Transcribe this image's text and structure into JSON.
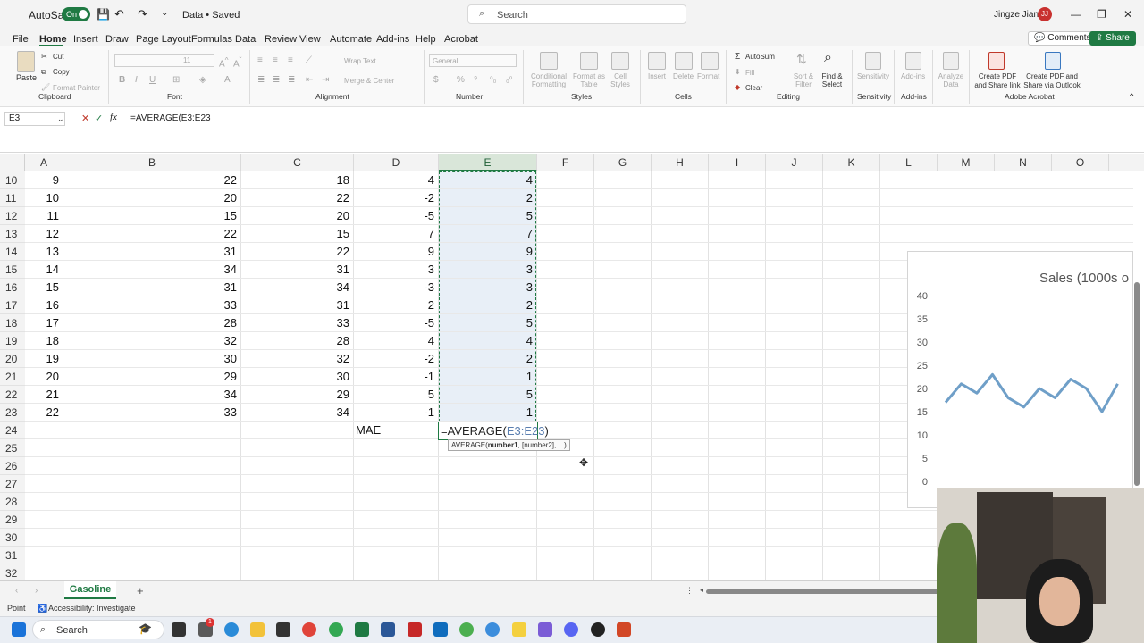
{
  "titlebar": {
    "autosave_label": "AutoSave",
    "autosave_state": "On",
    "doc_title": "Data • Saved",
    "search_placeholder": "Search",
    "user_name": "Jingze Jiang",
    "user_initials": "JJ"
  },
  "menu": {
    "items": [
      "File",
      "Home",
      "Insert",
      "Draw",
      "Page Layout",
      "Formulas",
      "Data",
      "Review",
      "View",
      "Automate",
      "Add-ins",
      "Help",
      "Acrobat"
    ],
    "active": "Home",
    "comments_label": "Comments",
    "share_label": "Share"
  },
  "ribbon": {
    "clipboard": {
      "paste": "Paste",
      "cut": "Cut",
      "copy": "Copy",
      "format_painter": "Format Painter",
      "group": "Clipboard"
    },
    "font": {
      "group": "Font",
      "size": "11"
    },
    "alignment": {
      "wrap": "Wrap Text",
      "merge": "Merge & Center",
      "group": "Alignment"
    },
    "number": {
      "format": "General",
      "group": "Number"
    },
    "styles": {
      "conditional": "Conditional Formatting",
      "format_table": "Format as Table",
      "cell_styles": "Cell Styles",
      "group": "Styles"
    },
    "cells": {
      "insert": "Insert",
      "delete": "Delete",
      "format": "Format",
      "group": "Cells"
    },
    "editing": {
      "autosum": "AutoSum",
      "fill": "Fill",
      "clear": "Clear",
      "sort": "Sort & Filter",
      "find": "Find & Select",
      "group": "Editing"
    },
    "sensitivity": {
      "label": "Sensitivity",
      "group": "Sensitivity"
    },
    "addins": {
      "label": "Add-ins",
      "group": "Add-ins"
    },
    "analyze": {
      "label": "Analyze Data"
    },
    "acrobat": {
      "pdf_link": "Create PDF and Share link",
      "pdf_outlook": "Create PDF and Share via Outlook",
      "group": "Adobe Acrobat"
    }
  },
  "formula_bar": {
    "name_box": "E3",
    "formula": "=AVERAGE(E3:E23"
  },
  "columns": [
    "A",
    "B",
    "C",
    "D",
    "E",
    "F",
    "G",
    "H",
    "I",
    "J",
    "K",
    "L",
    "M",
    "N",
    "O"
  ],
  "rows": [
    {
      "n": "10",
      "a": "9",
      "b": "22",
      "c": "18",
      "d": "4",
      "e": "4"
    },
    {
      "n": "11",
      "a": "10",
      "b": "20",
      "c": "22",
      "d": "-2",
      "e": "2"
    },
    {
      "n": "12",
      "a": "11",
      "b": "15",
      "c": "20",
      "d": "-5",
      "e": "5"
    },
    {
      "n": "13",
      "a": "12",
      "b": "22",
      "c": "15",
      "d": "7",
      "e": "7"
    },
    {
      "n": "14",
      "a": "13",
      "b": "31",
      "c": "22",
      "d": "9",
      "e": "9"
    },
    {
      "n": "15",
      "a": "14",
      "b": "34",
      "c": "31",
      "d": "3",
      "e": "3"
    },
    {
      "n": "16",
      "a": "15",
      "b": "31",
      "c": "34",
      "d": "-3",
      "e": "3"
    },
    {
      "n": "17",
      "a": "16",
      "b": "33",
      "c": "31",
      "d": "2",
      "e": "2"
    },
    {
      "n": "18",
      "a": "17",
      "b": "28",
      "c": "33",
      "d": "-5",
      "e": "5"
    },
    {
      "n": "19",
      "a": "18",
      "b": "32",
      "c": "28",
      "d": "4",
      "e": "4"
    },
    {
      "n": "20",
      "a": "19",
      "b": "30",
      "c": "32",
      "d": "-2",
      "e": "2"
    },
    {
      "n": "21",
      "a": "20",
      "b": "29",
      "c": "30",
      "d": "-1",
      "e": "1"
    },
    {
      "n": "22",
      "a": "21",
      "b": "34",
      "c": "29",
      "d": "5",
      "e": "5"
    },
    {
      "n": "23",
      "a": "22",
      "b": "33",
      "c": "34",
      "d": "-1",
      "e": "1"
    }
  ],
  "empty_rows": [
    "24",
    "25",
    "26",
    "27",
    "28",
    "29",
    "30",
    "31",
    "32"
  ],
  "mae_label": "MAE",
  "edit_cell": {
    "prefix": "=AVERAGE(",
    "ref": "E3:E23",
    "suffix": ")"
  },
  "tooltip": {
    "fn": "AVERAGE(",
    "arg1": "number1",
    ", rest": ", [number2], ...)"
  },
  "chart_data": {
    "type": "line",
    "title": "Sales (1000s o",
    "yticks": [
      "40",
      "35",
      "30",
      "25",
      "20",
      "15",
      "10",
      "5",
      "0"
    ],
    "ylim": [
      0,
      40
    ],
    "series": [
      {
        "values": [
          17,
          21,
          19,
          23,
          18,
          16,
          20,
          18,
          22,
          20,
          15,
          21
        ]
      }
    ]
  },
  "sheet_tab": "Gasoline",
  "status": {
    "mode": "Point",
    "accessibility": "Accessibility: Investigate"
  },
  "taskbar": {
    "search": "Search",
    "badge": "1"
  },
  "colors": {
    "excel_green": "#1f7a43",
    "series": "#6f9fc8"
  }
}
